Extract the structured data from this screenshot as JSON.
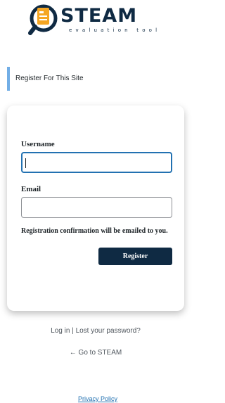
{
  "logo": {
    "word": "STEAM",
    "tagline": "evaluation tool",
    "colors": {
      "primary": "#0f2a43",
      "accent": "#f5a623"
    }
  },
  "message": "Register For This Site",
  "form": {
    "username_label": "Username",
    "username_value": "",
    "email_label": "Email",
    "email_value": "",
    "confirmation_note": "Registration confirmation will be emailed to you.",
    "register_label": "Register"
  },
  "nav": {
    "login": "Log in",
    "separator": "|",
    "lost_password": "Lost your password?",
    "back_link": "← Go to STEAM"
  },
  "footer": {
    "privacy_policy": "Privacy Policy"
  },
  "colors": {
    "button_bg": "#0f2a43",
    "focus_border": "#2271b1",
    "message_border": "#72aee6",
    "link": "#2271b1"
  }
}
